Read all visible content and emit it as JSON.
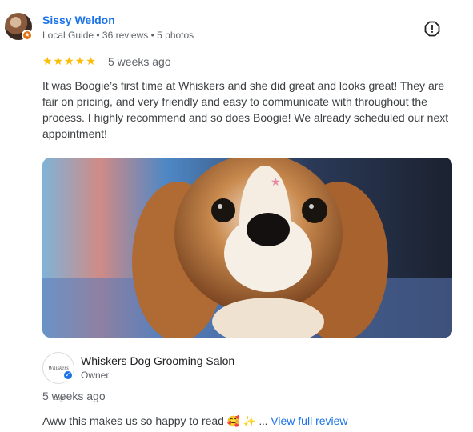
{
  "reviewer": {
    "name": "Sissy Weldon",
    "meta": "Local Guide • 36 reviews • 5 photos",
    "badge": "★"
  },
  "review": {
    "stars": "★★★★★",
    "rating": 5,
    "date": "5 weeks ago",
    "text": "It was Boogie’s first time at Whiskers and she did great and looks great! They are fair on pricing, and very friendly and easy to communicate with throughout the process. I highly recommend and so does Boogie! We already scheduled our next appointment!"
  },
  "owner": {
    "logo_text": "Whiskers Dog",
    "name": "Whiskers Dog Grooming Salon",
    "role": "Owner",
    "verified": "✓"
  },
  "reply": {
    "date": "5 weeks ago",
    "text": "Aww this makes us so happy to read ",
    "emoji": "🥰 ✨ ...",
    "view_full": "View full review"
  },
  "colors": {
    "accent": "#1a73e8",
    "star": "#fbbc04",
    "guide_badge": "#e8710a"
  }
}
